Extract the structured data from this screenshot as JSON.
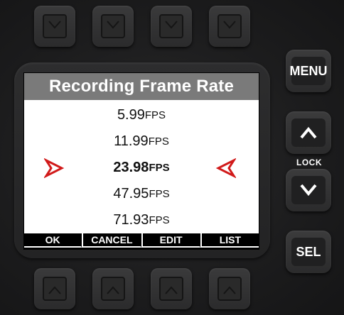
{
  "screen": {
    "title": "Recording Frame Rate",
    "options": [
      {
        "value": "5.99",
        "unit": "FPS"
      },
      {
        "value": "11.99",
        "unit": "FPS"
      },
      {
        "value": "23.98",
        "unit": "FPS"
      },
      {
        "value": "47.95",
        "unit": "FPS"
      },
      {
        "value": "71.93",
        "unit": "FPS"
      }
    ],
    "selected_value": "23.98",
    "softkeys": [
      "OK",
      "CANCEL",
      "EDIT",
      "LIST"
    ]
  },
  "side_buttons": {
    "menu_label": "MENU",
    "lock_label": "LOCK",
    "sel_label": "SEL"
  },
  "colors": {
    "title_bar": "#7a7a7a",
    "arrow_red": "#d11a1a"
  }
}
